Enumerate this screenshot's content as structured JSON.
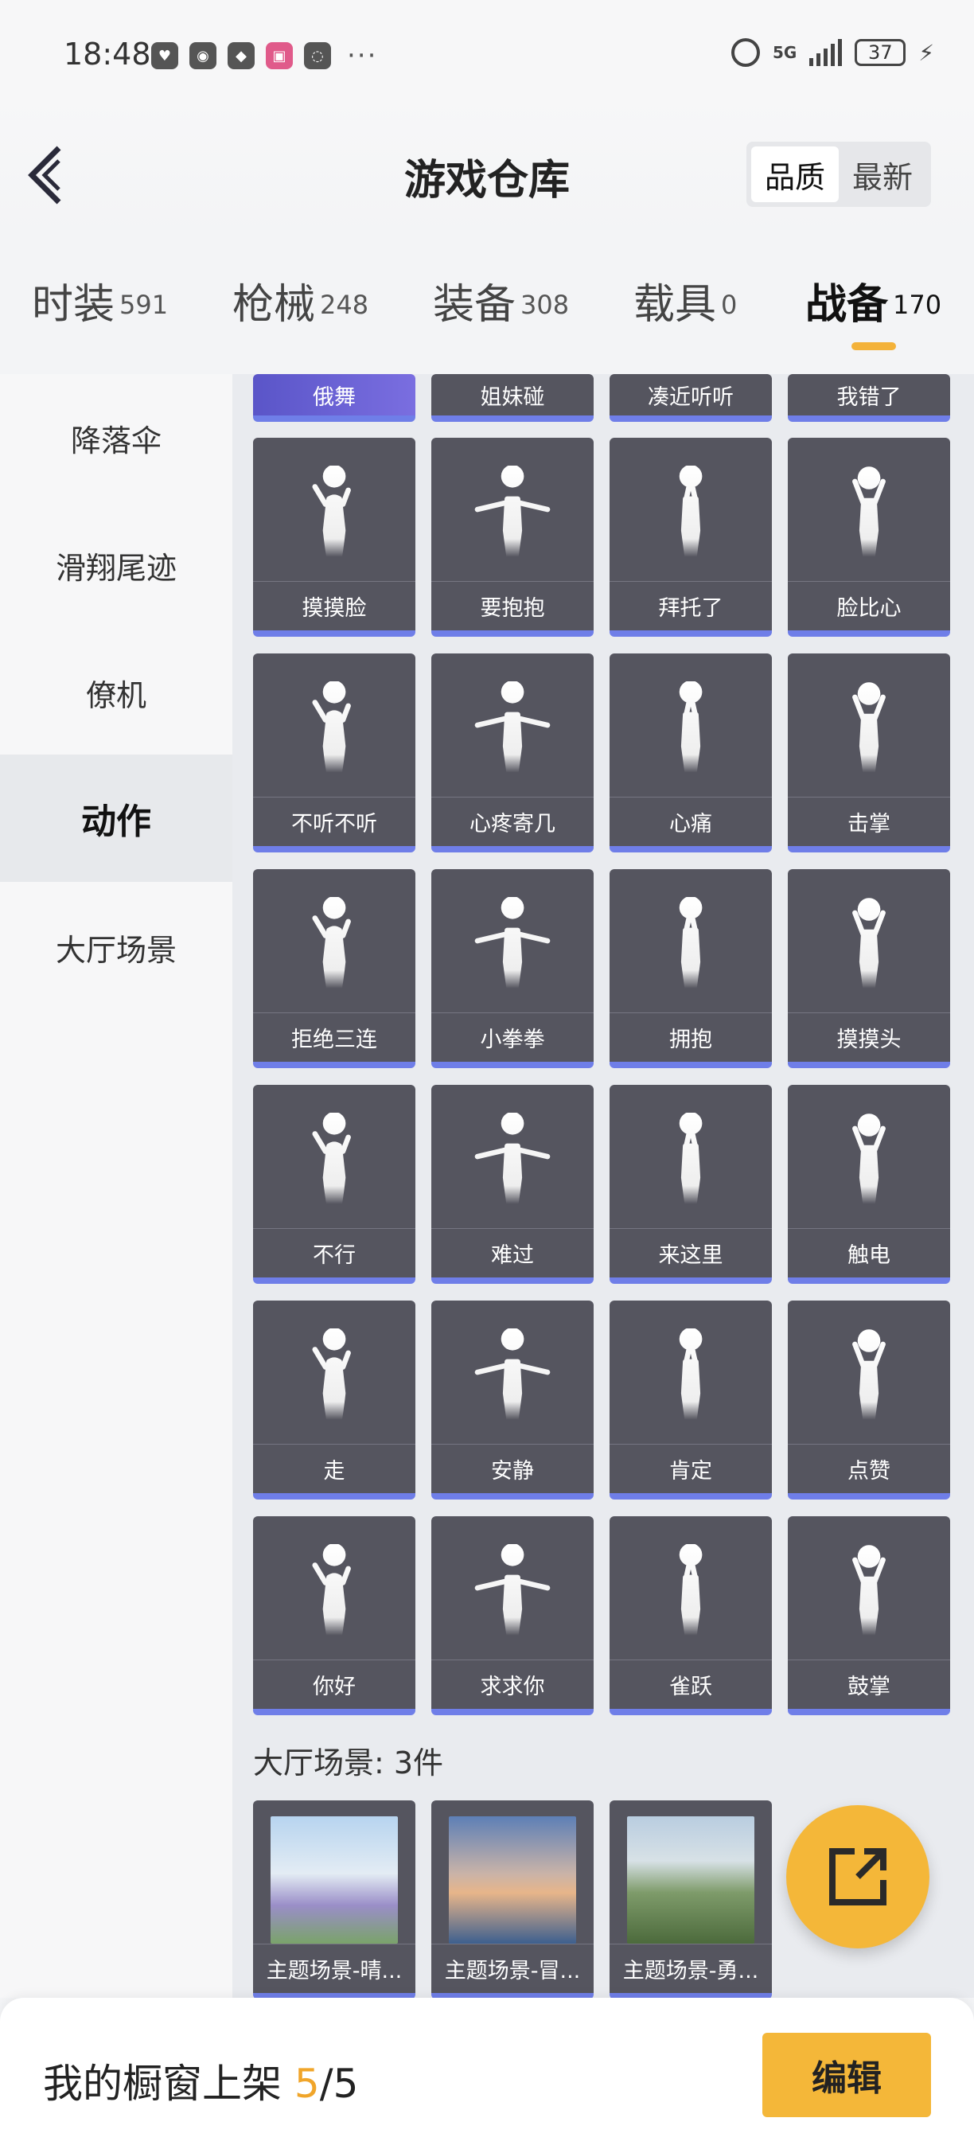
{
  "status_bar": {
    "time": "18:48",
    "network": "5G",
    "battery": "37"
  },
  "header": {
    "title": "游戏仓库",
    "sort_options": [
      "品质",
      "最新"
    ],
    "sort_selected": "品质"
  },
  "category_tabs": [
    {
      "label": "时装",
      "count": "591"
    },
    {
      "label": "枪械",
      "count": "248"
    },
    {
      "label": "装备",
      "count": "308"
    },
    {
      "label": "载具",
      "count": "0"
    },
    {
      "label": "战备",
      "count": "170",
      "active": true
    }
  ],
  "side_nav": [
    {
      "label": "降落伞"
    },
    {
      "label": "滑翔尾迹"
    },
    {
      "label": "僚机"
    },
    {
      "label": "动作",
      "active": true
    },
    {
      "label": "大厅场景"
    }
  ],
  "partial_row": [
    "俄舞",
    "姐妹碰",
    "凑近听听",
    "我错了"
  ],
  "action_items": [
    "摸摸脸",
    "要抱抱",
    "拜托了",
    "脸比心",
    "不听不听",
    "心疼寄几",
    "心痛",
    "击掌",
    "拒绝三连",
    "小拳拳",
    "拥抱",
    "摸摸头",
    "不行",
    "难过",
    "来这里",
    "触电",
    "走",
    "安静",
    "肯定",
    "点赞",
    "你好",
    "求求你",
    "雀跃",
    "鼓掌"
  ],
  "lobby_section": {
    "heading": "大厅场景: 3件",
    "items": [
      "主题场景-晴...",
      "主题场景-冒...",
      "主题场景-勇..."
    ]
  },
  "bottom_bar": {
    "label": "我的橱窗上架 ",
    "current": "5",
    "sep_total": "/5",
    "edit_label": "编辑"
  },
  "colors": {
    "accent": "#f4b739",
    "card_bg": "#55555f",
    "card_underline": "#6f7ee8"
  }
}
